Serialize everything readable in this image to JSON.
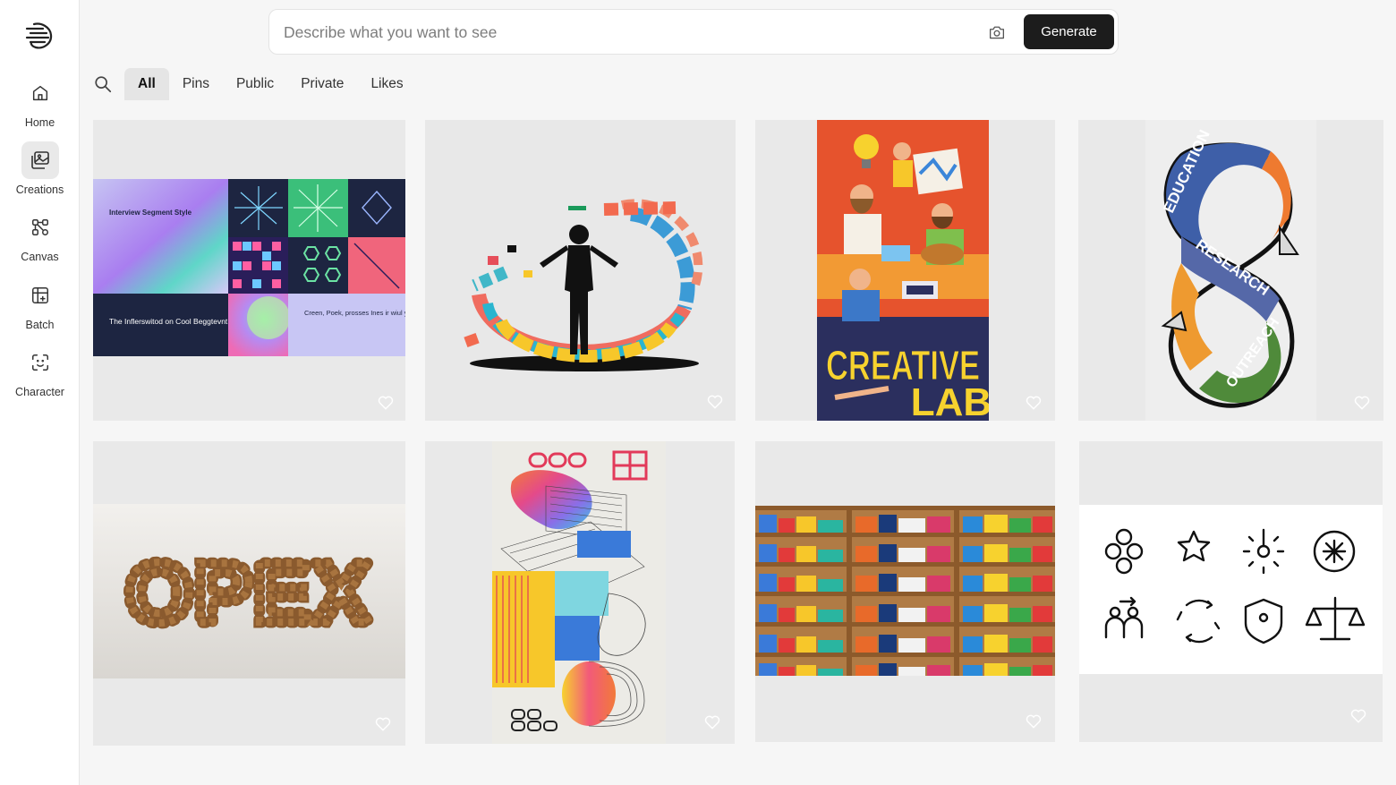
{
  "sidebar": {
    "items": [
      {
        "label": "Home",
        "icon": "home-icon"
      },
      {
        "label": "Creations",
        "icon": "images-icon",
        "active": true
      },
      {
        "label": "Canvas",
        "icon": "canvas-nodes-icon"
      },
      {
        "label": "Batch",
        "icon": "batch-grid-icon"
      },
      {
        "label": "Character",
        "icon": "face-scan-icon"
      }
    ]
  },
  "prompt": {
    "placeholder": "Describe what you want to see",
    "value": "",
    "generate_label": "Generate"
  },
  "filters": {
    "tabs": [
      "All",
      "Pins",
      "Public",
      "Private",
      "Likes"
    ],
    "active": "All"
  },
  "gallery": {
    "cards": [
      {
        "name": "interview-segment-style",
        "texts": [
          "Interview Segment Style",
          "The Inflerswitod on Cool Beggtevnt",
          "Creen, Poek, prosses Ines ir wiul yiag is or black a fock"
        ]
      },
      {
        "name": "silhouette-color-ring",
        "texts": []
      },
      {
        "name": "creative-lab-poster",
        "texts": [
          "CREATIVE",
          "LAB"
        ]
      },
      {
        "name": "education-research-outreach",
        "texts": [
          "EDUCATION",
          "RESEARCH",
          "OUTREACH"
        ]
      },
      {
        "name": "opex-walnuts",
        "texts": [
          "OPEX"
        ]
      },
      {
        "name": "abstract-poster",
        "texts": []
      },
      {
        "name": "bookshelf-photo",
        "texts": []
      },
      {
        "name": "icon-set",
        "texts": []
      }
    ]
  },
  "colors": {
    "accent": "#1c1c1c",
    "background": "#f6f6f6",
    "card": "#e9e9e9"
  }
}
